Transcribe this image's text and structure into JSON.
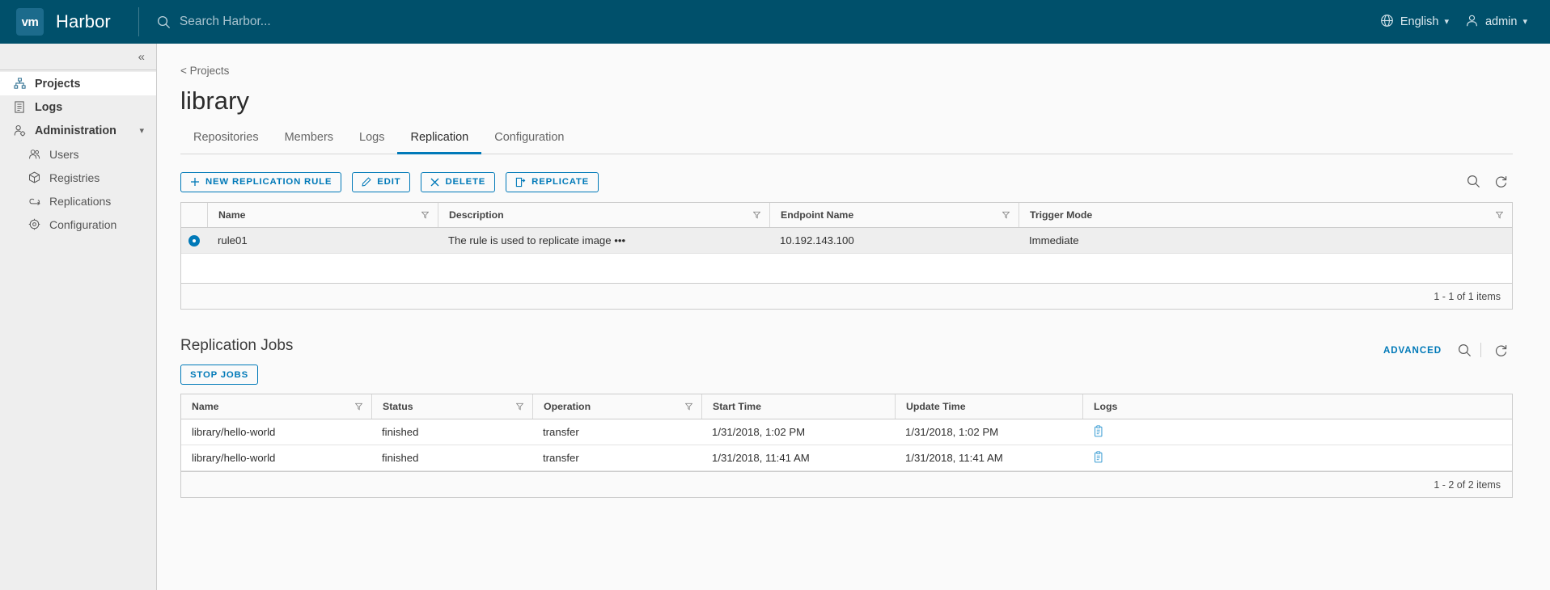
{
  "header": {
    "logo_text": "vm",
    "logo_icon": "vmware-logo-icon",
    "brand": "Harbor",
    "search_icon": "search-icon",
    "search_placeholder": "Search Harbor...",
    "globe_icon": "globe-icon",
    "language": "English",
    "user_icon": "user-icon",
    "user": "admin",
    "caret": "⌄",
    "bg_color": "#00506b"
  },
  "sidebar": {
    "collapse_icon": "«",
    "collapse_name": "collapse-sidebar-button",
    "items": [
      {
        "label": "Projects",
        "icon": "projects-icon",
        "level": 0,
        "active": true,
        "name": "sidebar-item-projects"
      },
      {
        "label": "Logs",
        "icon": "logs-icon",
        "level": 0,
        "active": false,
        "name": "sidebar-item-logs"
      },
      {
        "label": "Administration",
        "icon": "administration-icon",
        "level": 0,
        "active": false,
        "expanded": true,
        "name": "sidebar-item-administration"
      },
      {
        "label": "Users",
        "icon": "users-icon",
        "level": 1,
        "active": false,
        "name": "sidebar-item-users"
      },
      {
        "label": "Registries",
        "icon": "registries-icon",
        "level": 1,
        "active": false,
        "name": "sidebar-item-registries"
      },
      {
        "label": "Replications",
        "icon": "replications-icon",
        "level": 1,
        "active": false,
        "name": "sidebar-item-replications"
      },
      {
        "label": "Configuration",
        "icon": "configuration-icon",
        "level": 1,
        "active": false,
        "name": "sidebar-item-configuration"
      }
    ]
  },
  "page": {
    "breadcrumb": "< Projects",
    "title": "library",
    "tabs": [
      {
        "label": "Repositories",
        "active": false
      },
      {
        "label": "Members",
        "active": false
      },
      {
        "label": "Logs",
        "active": false
      },
      {
        "label": "Replication",
        "active": true
      },
      {
        "label": "Configuration",
        "active": false
      }
    ],
    "accent_color": "#0079b8"
  },
  "rules_toolbar": {
    "new_rule": "NEW REPLICATION RULE",
    "edit": "EDIT",
    "delete": "DELETE",
    "replicate": "REPLICATE",
    "search_icon": "search-icon",
    "refresh_icon": "refresh-icon"
  },
  "rules_table": {
    "columns": [
      {
        "label": "Name",
        "filter": true
      },
      {
        "label": "Description",
        "filter": true
      },
      {
        "label": "Endpoint Name",
        "filter": true
      },
      {
        "label": "Trigger Mode",
        "filter": true
      }
    ],
    "rows": [
      {
        "selected": true,
        "name": "rule01",
        "description": "The rule is used to replicate image •••",
        "endpoint": "10.192.143.100",
        "trigger": "Immediate"
      }
    ],
    "pagination": "1 - 1 of 1 items"
  },
  "jobs": {
    "title": "Replication Jobs",
    "advanced": "ADVANCED",
    "search_icon": "search-icon",
    "refresh_icon": "refresh-icon",
    "stop_jobs": "STOP JOBS",
    "columns": [
      {
        "label": "Name",
        "filter": true
      },
      {
        "label": "Status",
        "filter": true
      },
      {
        "label": "Operation",
        "filter": true
      },
      {
        "label": "Start Time",
        "filter": false
      },
      {
        "label": "Update Time",
        "filter": false
      },
      {
        "label": "Logs",
        "filter": false
      }
    ],
    "rows": [
      {
        "name": "library/hello-world",
        "status": "finished",
        "operation": "transfer",
        "start_time": "1/31/2018, 1:02 PM",
        "update_time": "1/31/2018, 1:02 PM",
        "log_icon": "clipboard-log-icon"
      },
      {
        "name": "library/hello-world",
        "status": "finished",
        "operation": "transfer",
        "start_time": "1/31/2018, 11:41 AM",
        "update_time": "1/31/2018, 11:41 AM",
        "log_icon": "clipboard-log-icon"
      }
    ],
    "pagination": "1 - 2 of 2 items"
  }
}
